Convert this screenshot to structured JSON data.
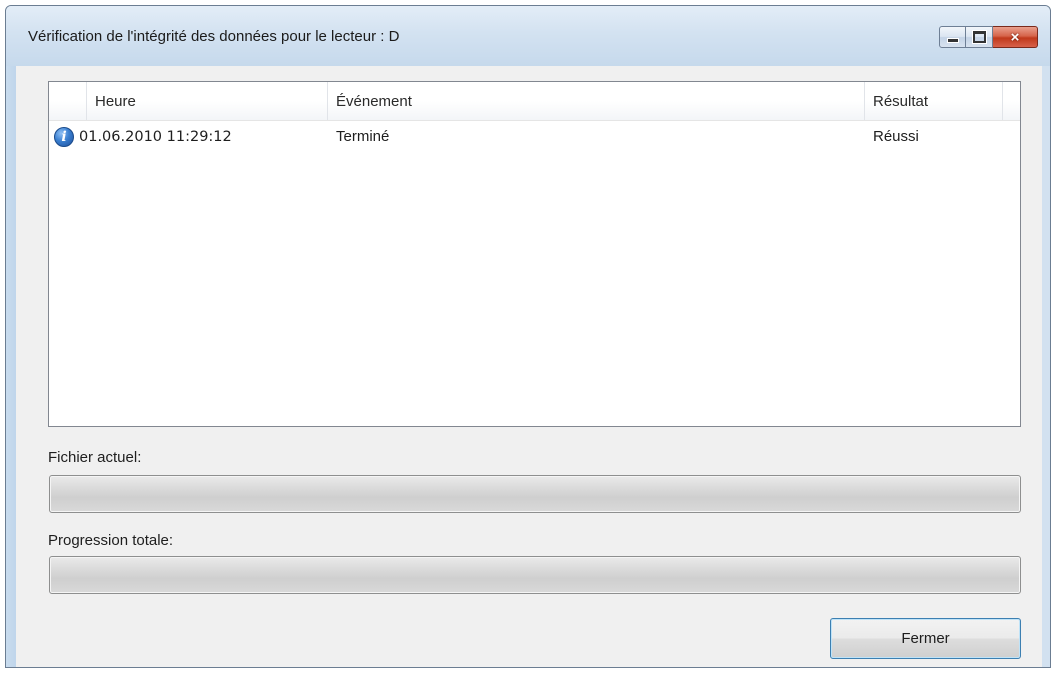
{
  "window": {
    "title": "Vérification de l'intégrité des données pour le lecteur : D",
    "controls": {
      "minimize": "minimize",
      "maximize": "maximize",
      "close": "×"
    }
  },
  "log": {
    "columns": [
      "Heure",
      "Événement",
      "Résultat"
    ],
    "rows": [
      {
        "icon": "info-icon",
        "time": "01.06.2010 11:29:12",
        "event": "Terminé",
        "result": "Réussi"
      }
    ]
  },
  "progress": {
    "current_file_label": "Fichier actuel:",
    "current_file_value": 0,
    "total_label": "Progression totale:",
    "total_value": 0
  },
  "buttons": {
    "close_label": "Fermer"
  },
  "colors": {
    "title_bar": "#d3e2f1",
    "client_bg": "#f0f0f0",
    "close_button": "#c0391b",
    "info_icon": "#3a7fd0",
    "button_focus_border": "#3c7fb1"
  }
}
